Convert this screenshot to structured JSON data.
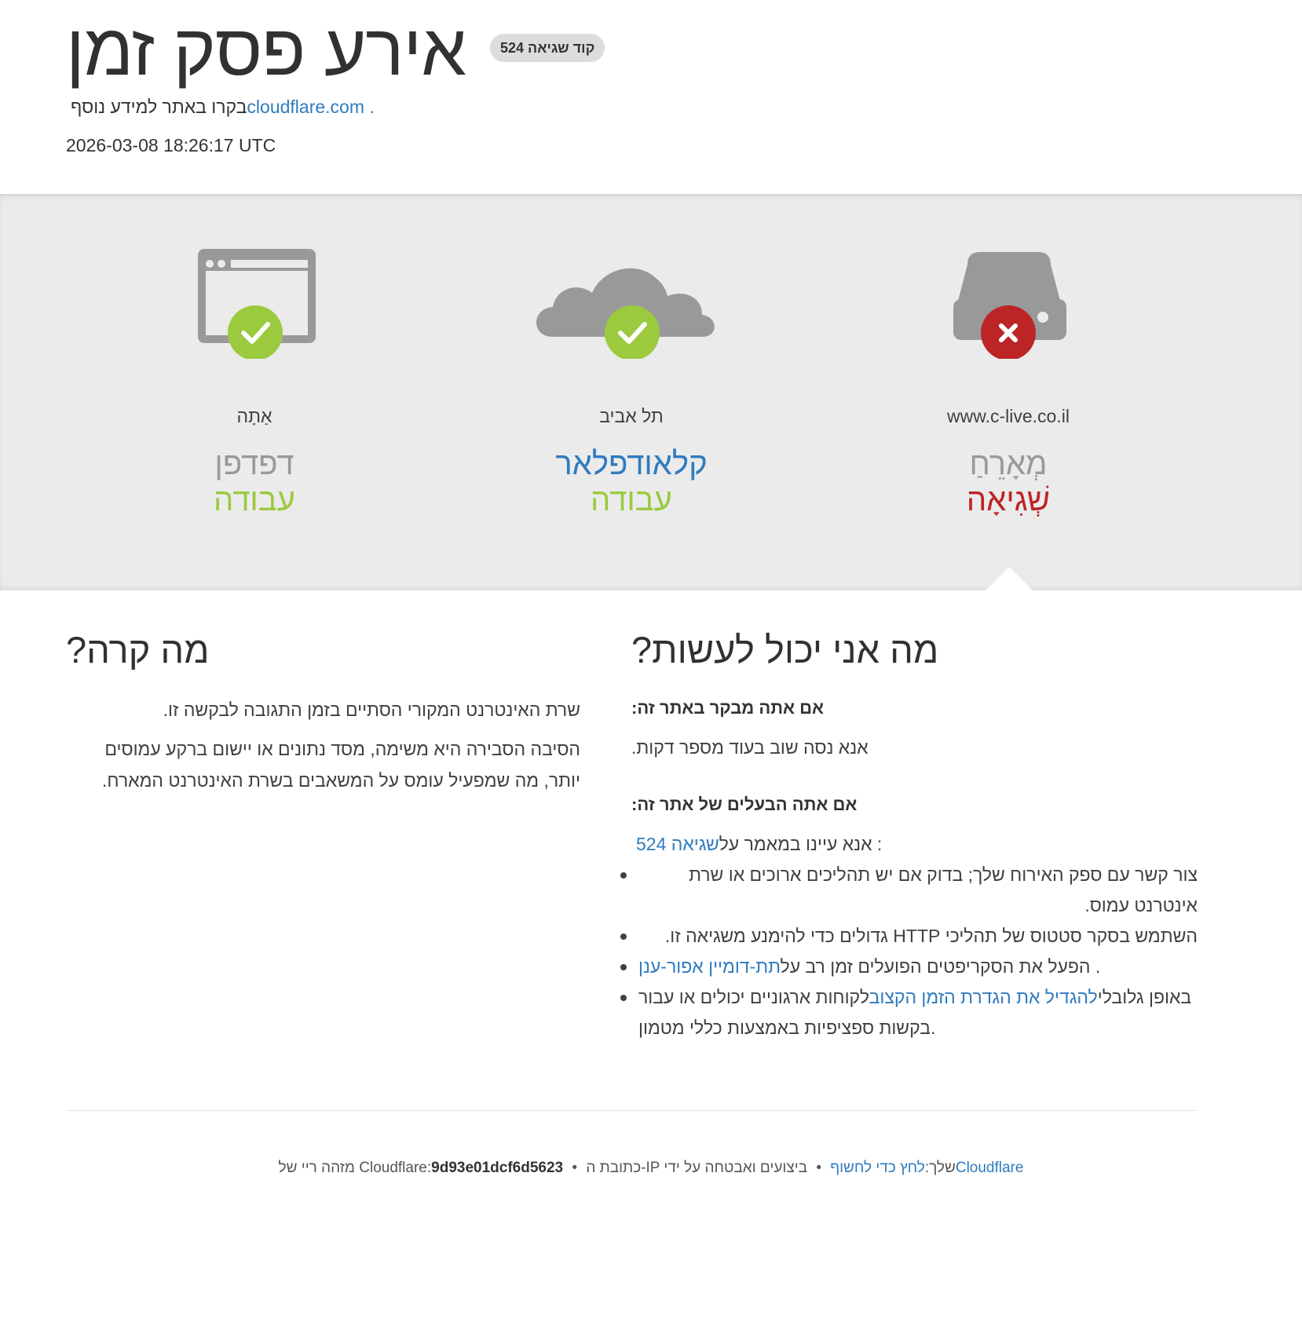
{
  "header": {
    "title": "אירע פסק זמן",
    "error_code_badge": "קוד שגיאה 524",
    "visit_text": "בקרו באתר למידע נוסף",
    "visit_link": "cloudflare.com .",
    "timestamp": "2026-03-08 18:26:17 UTC"
  },
  "status": {
    "browser": {
      "location": "אַתָה",
      "role": "דפדפן",
      "state": "עבודה",
      "icon": "browser-window-icon",
      "badge": "check-icon"
    },
    "cloudflare": {
      "location": "תל אביב",
      "role": "קלאודפלאר",
      "state": "עבודה",
      "icon": "cloud-icon",
      "badge": "check-icon"
    },
    "host": {
      "location": "www.c-live.co.il",
      "role": "מְאָרֵחַ",
      "state": "שְׁגִיאָה",
      "icon": "server-icon",
      "badge": "x-icon"
    }
  },
  "colors": {
    "ok": "#9bca3e",
    "error": "#bd2426",
    "link": "#2f7bbf",
    "icon_gray": "#999999",
    "band": "#ebebeb"
  },
  "what_happened": {
    "title": "מה קרה?",
    "p1": "שרת האינטרנט המקורי הסתיים בזמן התגובה לבקשה זו.",
    "p2": "הסיבה הסבירה היא משימה, מסד נתונים או יישום ברקע עמוסים יותר, מה שמפעיל עומס על המשאבים בשרת האינטרנט המארח."
  },
  "what_can_i_do": {
    "title": "מה אני יכול לעשות?",
    "visitor_heading": "אם אתה מבקר באתר זה:",
    "visitor_text": "אנא נסה שוב בעוד מספר דקות.",
    "owner_heading": "אם אתה הבעלים של אתר זה:",
    "owner_intro_pre": "אנא עיינו במאמר על",
    "owner_intro_link": "שגיאה 524",
    "owner_intro_post": " :",
    "item1": "צור קשר עם ספק האירוח שלך; בדוק אם יש תהליכים ארוכים או שרת אינטרנט עמוס.",
    "item2": "השתמש בסקר סטטוס של תהליכי HTTP גדולים כדי להימנע משגיאה זו.",
    "item3_pre": "הפעל את הסקריפטים הפועלים זמן רב על",
    "item3_link": "תת-דומיין אפור-ענן",
    "item3_post": " .",
    "item4_pre": "באופן גלובלי",
    "item4_link": "להגדיל את הגדרת הזמן הקצוב",
    "item4_post": "לקוחות ארגוניים יכולים או עבור בקשות ספציפיות באמצעות כללי מטמון."
  },
  "footer": {
    "ray_label": "מזהה ריי של Cloudflare:",
    "ray_id": "9d93e01dcf6d5623",
    "ip_label": "כתובת ה-IP שלך:",
    "ip_reveal": "לחץ כדי לחשוף",
    "perf_label": "ביצועים ואבטחה על ידי",
    "perf_link": "Cloudflare",
    "separator": "•"
  }
}
